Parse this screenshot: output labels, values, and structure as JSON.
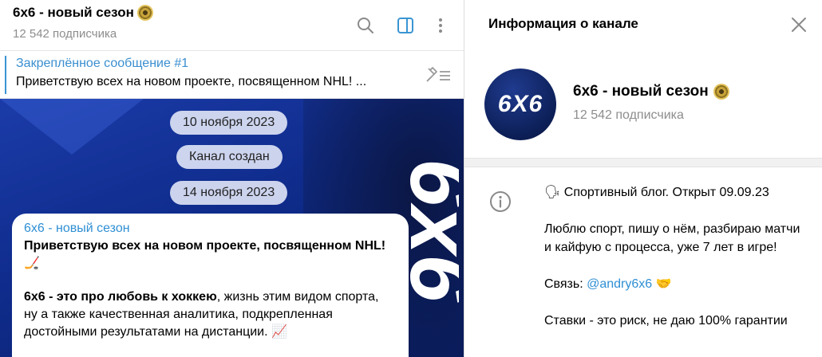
{
  "chat": {
    "title": "6x6 - новый сезон",
    "subscribers": "12 542 подписчика",
    "header_icons": [
      "search-icon",
      "sidebar-toggle-icon",
      "more-vertical-icon"
    ],
    "accent_color": "#3a95d3"
  },
  "pinned": {
    "title": "Закреплённое сообщение #1",
    "text": "Приветствую всех на новом проекте, посвященном NHL! ..."
  },
  "service": {
    "date1": "10 ноября 2023",
    "created": "Канал создан",
    "date2": "14 ноября 2023"
  },
  "message": {
    "author": "6x6 - новый сезон",
    "line1": "Приветствую всех на новом проекте, посвященном NHL!",
    "emoji1": "🏒",
    "line2_bold": "6x6 -  это про любовь к хоккею",
    "line2_rest": ", жизнь этим видом спорта,",
    "line3": "ну а также качественная аналитика, подкрепленная",
    "line4": "достойными результатами на дистанции.",
    "emoji2": "📈"
  },
  "info": {
    "header": "Информация о канале",
    "avatar_text": "6X6",
    "name": "6x6 - новый сезон",
    "subscribers": "12 542 подписчика",
    "desc_line1": "🗣 Спортивный блог. Открыт 09.09.23",
    "desc_para2": "Люблю спорт, пишу о нём, разбираю матчи и кайфую с процесса, уже 7 лет в игре!",
    "contact_label": "Связь:",
    "contact_link": "@andry6x6",
    "contact_emoji": "🤝",
    "desc_para4": "Ставки - это риск, не даю 100% гарантии"
  },
  "background_logo_text": "6x6"
}
